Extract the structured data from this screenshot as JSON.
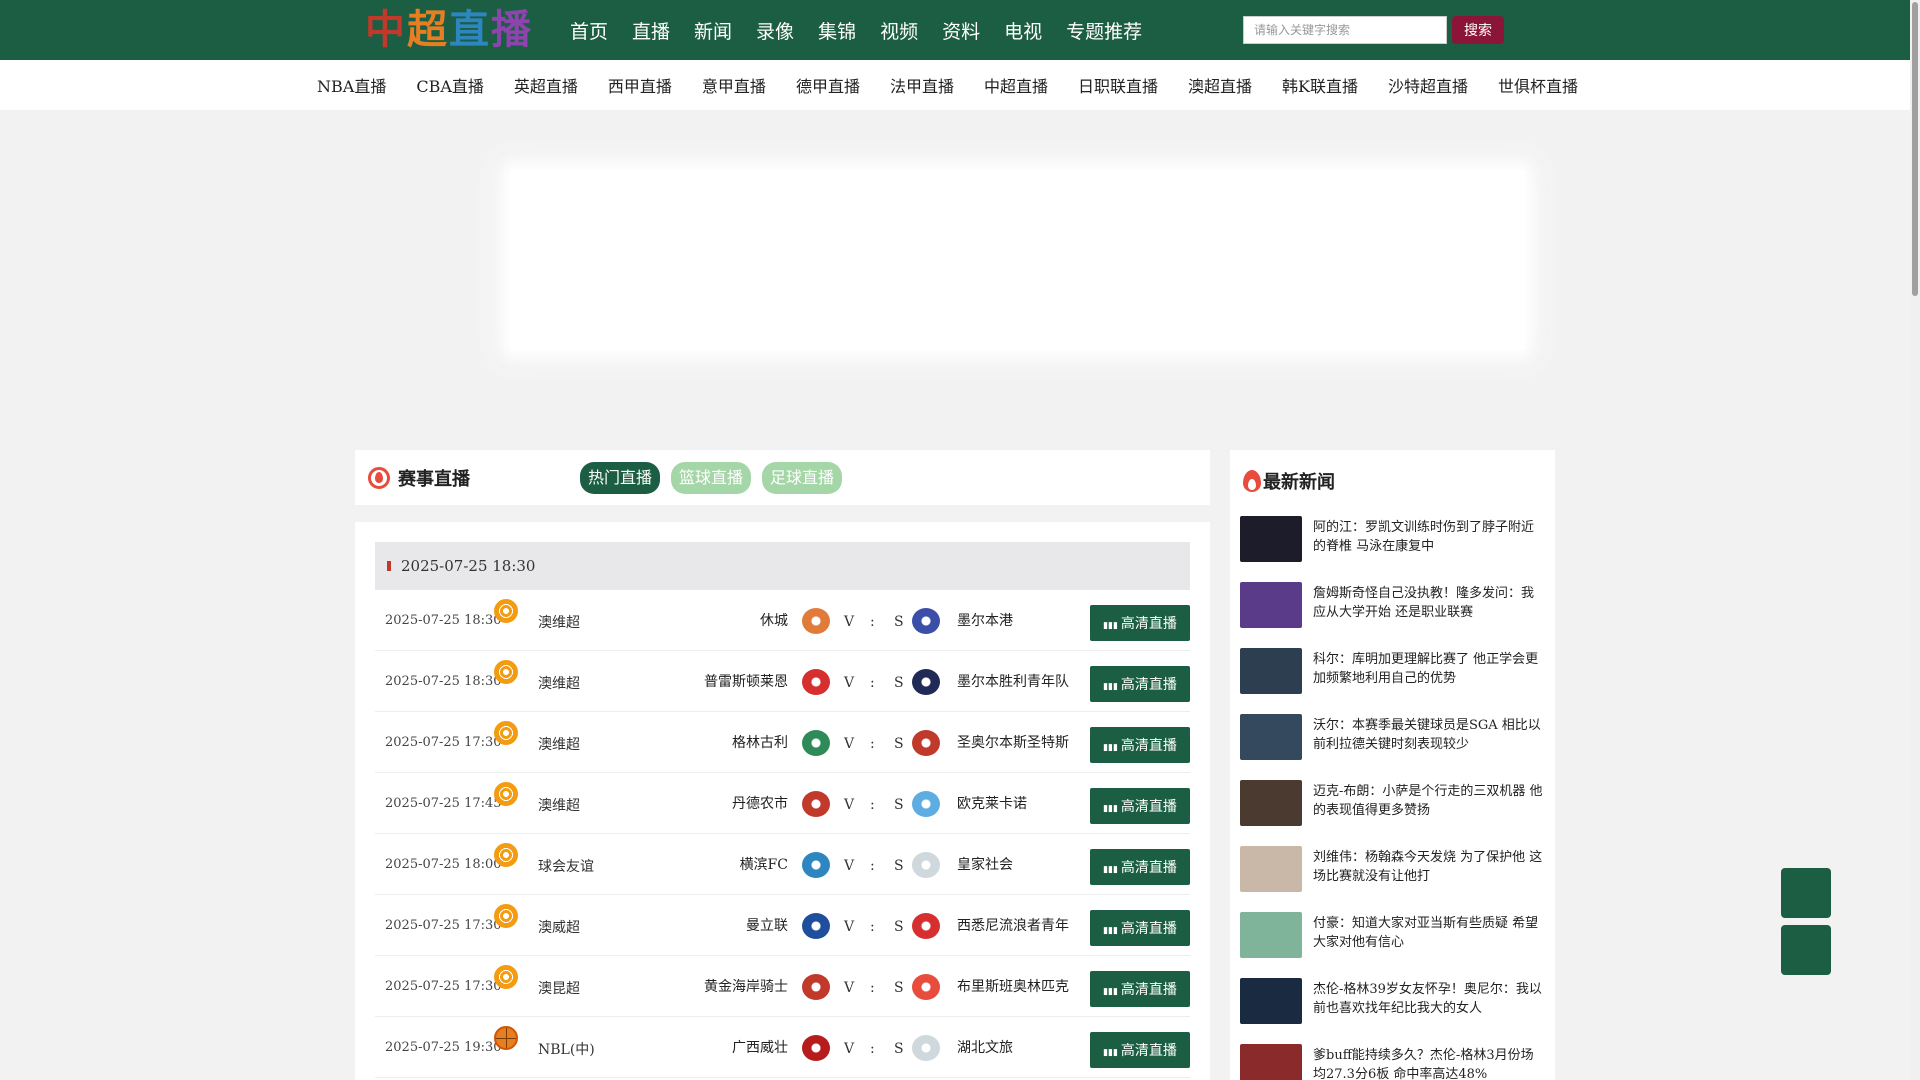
{
  "header": {
    "logo_text": "中超直播",
    "nav": [
      "首页",
      "直播",
      "新闻",
      "录像",
      "集锦",
      "视频",
      "资料",
      "电视",
      "专题推荐"
    ],
    "search_placeholder": "请输入关键字搜索",
    "search_button": "搜索"
  },
  "subnav": [
    "NBA直播",
    "CBA直播",
    "英超直播",
    "西甲直播",
    "意甲直播",
    "德甲直播",
    "法甲直播",
    "中超直播",
    "日职联直播",
    "澳超直播",
    "韩K联直播",
    "沙特超直播",
    "世俱杯直播"
  ],
  "schedule": {
    "title": "赛事直播",
    "tabs": [
      "热门直播",
      "篮球直播",
      "足球直播"
    ],
    "date_header": "2025-07-25 18:30",
    "button_label": "高清直播",
    "vs": [
      "V",
      ":",
      "S"
    ],
    "matches": [
      {
        "time": "2025-07-25 18:30",
        "sport": "football",
        "league": "澳维超",
        "home": "休城",
        "away": "墨尔本港",
        "home_color": "#e07b39",
        "away_color": "#3b4fa8"
      },
      {
        "time": "2025-07-25 18:30",
        "sport": "football",
        "league": "澳维超",
        "home": "普雷斯顿莱恩",
        "away": "墨尔本胜利青年队",
        "home_color": "#d62f2f",
        "away_color": "#1f2a56"
      },
      {
        "time": "2025-07-25 17:30",
        "sport": "football",
        "league": "澳维超",
        "home": "格林古利",
        "away": "圣奥尔本斯圣特斯",
        "home_color": "#2e8b57",
        "away_color": "#c0392b"
      },
      {
        "time": "2025-07-25 17:45",
        "sport": "football",
        "league": "澳维超",
        "home": "丹德农市",
        "away": "欧克莱卡诺",
        "home_color": "#c0392b",
        "away_color": "#5dade2"
      },
      {
        "time": "2025-07-25 18:00",
        "sport": "football",
        "league": "球会友谊",
        "home": "横滨FC",
        "away": "皇家社会",
        "home_color": "#2e86c1",
        "away_color": "#cfd8dc"
      },
      {
        "time": "2025-07-25 17:30",
        "sport": "football",
        "league": "澳威超",
        "home": "曼立联",
        "away": "西悉尼流浪者青年",
        "home_color": "#1f4e9c",
        "away_color": "#d62f2f"
      },
      {
        "time": "2025-07-25 17:30",
        "sport": "football",
        "league": "澳昆超",
        "home": "黄金海岸骑士",
        "away": "布里斯班奥林匹克",
        "home_color": "#c0392b",
        "away_color": "#e74c3c"
      },
      {
        "time": "2025-07-25 19:30",
        "sport": "basketball",
        "league": "NBL(中)",
        "home": "广西威壮",
        "away": "湖北文旅",
        "home_color": "#b71c1c",
        "away_color": "#cfd8dc"
      }
    ]
  },
  "news": {
    "title": "最新新闻",
    "items": [
      {
        "text": "阿的江：罗凯文训练时伤到了脖子附近的脊椎 马泳在康复中",
        "thumb_color": "#1c1c2a"
      },
      {
        "text": "詹姆斯奇怪自己没执教！隆多发问：我应从大学开始 还是职业联赛",
        "thumb_color": "#5a3b8a"
      },
      {
        "text": "科尔：库明加更理解比赛了 他正学会更加频繁地利用自己的优势",
        "thumb_color": "#2c3e50"
      },
      {
        "text": "沃尔：本赛季最关键球员是SGA 相比以前利拉德关键时刻表现较少",
        "thumb_color": "#34495e"
      },
      {
        "text": "迈克-布朗：小萨是个行走的三双机器 他的表现值得更多赞扬",
        "thumb_color": "#4a3a30"
      },
      {
        "text": "刘维伟：杨翰森今天发烧 为了保护他 这场比赛就没有让他打",
        "thumb_color": "#c9b8a8"
      },
      {
        "text": "付豪：知道大家对亚当斯有些质疑 希望大家对他有信心",
        "thumb_color": "#7fb39a"
      },
      {
        "text": "杰伦-格林39岁女友怀孕！奥尼尔：我以前也喜欢找年纪比我大的女人",
        "thumb_color": "#1a2a40"
      },
      {
        "text": "爹buff能持续多久？杰伦-格林3月份场均27.3分6板 命中率高达48%",
        "thumb_color": "#8b2a2a"
      }
    ]
  }
}
